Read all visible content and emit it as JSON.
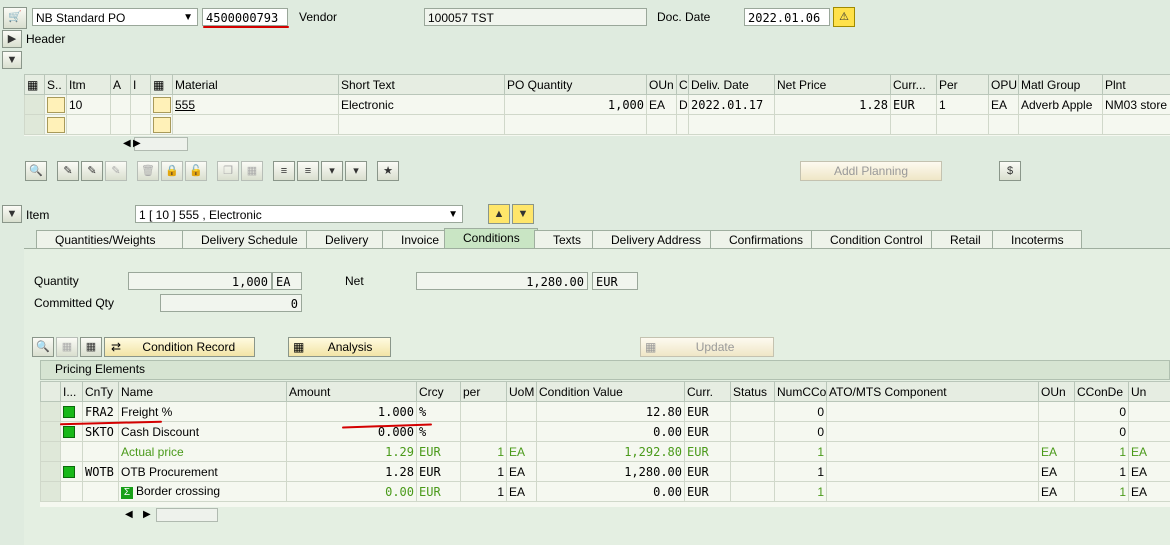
{
  "top": {
    "doc_type": "NB Standard PO",
    "po_number": "4500000793",
    "vendor_label": "Vendor",
    "vendor_value": "100057 TST",
    "doc_date_label": "Doc. Date",
    "doc_date_value": "2022.01.06"
  },
  "header_label": "Header",
  "items_table": {
    "columns": [
      "S..",
      "Itm",
      "A",
      "I",
      "Material",
      "Short Text",
      "PO Quantity",
      "OUn",
      "C",
      "Deliv. Date",
      "Net Price",
      "Curr...",
      "Per",
      "OPU",
      "Matl Group",
      "Plnt"
    ],
    "rows": [
      {
        "itm": "10",
        "a": "",
        "i": "",
        "material": "555",
        "short_text": "Electronic",
        "qty": "1,000",
        "oun": "EA",
        "c": "D",
        "deliv": "2022.01.17",
        "price": "1.28",
        "curr": "EUR",
        "per": "1",
        "opu": "EA",
        "matl_group": "Adverb Apple",
        "plnt": "NM03 store"
      }
    ]
  },
  "addl_planning": "Addl Planning",
  "item_label": "Item",
  "item_select": "1 [ 10 ] 555 , Electronic",
  "tabs": [
    "Quantities/Weights",
    "Delivery Schedule",
    "Delivery",
    "Invoice",
    "Conditions",
    "Texts",
    "Delivery Address",
    "Confirmations",
    "Condition Control",
    "Retail",
    "Incoterms"
  ],
  "active_tab": "Conditions",
  "conditions": {
    "quantity_label": "Quantity",
    "quantity_value": "1,000",
    "quantity_unit": "EA",
    "net_label": "Net",
    "net_value": "1,280.00",
    "net_curr": "EUR",
    "committed_label": "Committed Qty",
    "committed_value": "0",
    "condition_record": "Condition Record",
    "analysis": "Analysis",
    "update": "Update"
  },
  "pricing": {
    "title": "Pricing Elements",
    "columns": [
      "I...",
      "CnTy",
      "Name",
      "Amount",
      "Crcy",
      "per",
      "UoM",
      "Condition Value",
      "Curr.",
      "Status",
      "NumCCo",
      "ATO/MTS Component",
      "OUn",
      "CConDe",
      "Un"
    ],
    "rows": [
      {
        "ind": true,
        "cnty": "FRA2",
        "name": "Freight %",
        "amount": "1.000",
        "crcy": "%",
        "per": "",
        "uom": "",
        "value": "12.80",
        "curr": "EUR",
        "status": "",
        "numcco": "0",
        "ato": "",
        "oun": "",
        "ccon": "0",
        "un": "",
        "style": "normal"
      },
      {
        "ind": true,
        "cnty": "SKTO",
        "name": "Cash Discount",
        "amount": "0.000",
        "crcy": "%",
        "per": "",
        "uom": "",
        "value": "0.00",
        "curr": "EUR",
        "status": "",
        "numcco": "0",
        "ato": "",
        "oun": "",
        "ccon": "0",
        "un": "",
        "style": "normal"
      },
      {
        "ind": false,
        "cnty": "",
        "name": "Actual price",
        "amount": "1.29",
        "crcy": "EUR",
        "per": "1",
        "uom": "EA",
        "value": "1,292.80",
        "curr": "EUR",
        "status": "",
        "numcco": "1",
        "ato": "",
        "oun": "EA",
        "ccon": "1",
        "un": "EA",
        "style": "green"
      },
      {
        "ind": true,
        "cnty": "WOTB",
        "name": "OTB Procurement",
        "amount": "1.28",
        "crcy": "EUR",
        "per": "1",
        "uom": "EA",
        "value": "1,280.00",
        "curr": "EUR",
        "status": "",
        "numcco": "1",
        "ato": "",
        "oun": "EA",
        "ccon": "1",
        "un": "EA",
        "style": "normal"
      },
      {
        "ind": false,
        "cnty": "",
        "name": "Border crossing",
        "amount": "0.00",
        "crcy": "EUR",
        "per": "1",
        "uom": "EA",
        "value": "0.00",
        "curr": "EUR",
        "status": "",
        "numcco": "1",
        "ato": "",
        "oun": "EA",
        "ccon": "1",
        "un": "EA",
        "style": "sum"
      }
    ]
  },
  "colors": {
    "background": "#dfebdf",
    "active_tab": "#c9e5c4",
    "subtotal_green": "#4a9a1a",
    "status_green": "#18b818",
    "annotation_red": "#d40000"
  }
}
